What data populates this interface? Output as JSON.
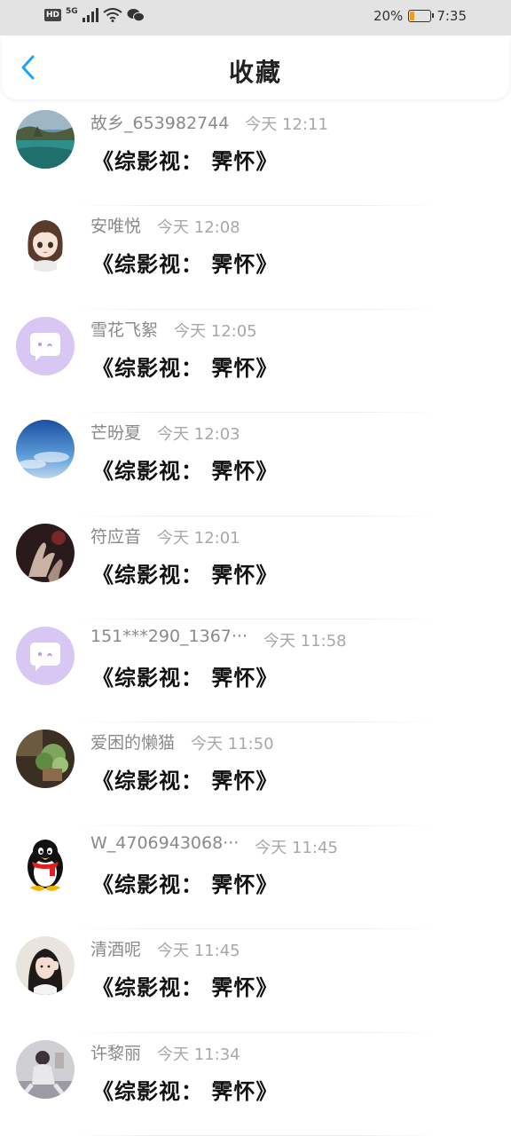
{
  "status_bar": {
    "hd": "HD",
    "network": "5G",
    "battery_text": "20%",
    "battery_level": 0.2,
    "time": "7:35"
  },
  "nav": {
    "title": "收藏",
    "back_icon": "chevron-left-icon",
    "accent_color": "#1ea0ff"
  },
  "message_text": "《综影视： 霁怀》",
  "items": [
    {
      "name": "故乡_653982744",
      "time": "今天 12:11",
      "avatar": "landscape-lake"
    },
    {
      "name": "安唯悦",
      "time": "今天 12:08",
      "avatar": "anime-girl"
    },
    {
      "name": "雪花飞絮",
      "time": "今天 12:05",
      "avatar": "default-purple"
    },
    {
      "name": "芒昐夏",
      "time": "今天 12:03",
      "avatar": "blue-sky"
    },
    {
      "name": "符应音",
      "time": "今天 12:01",
      "avatar": "dark-hands"
    },
    {
      "name": "151***290_1367···",
      "time": "今天 11:58",
      "avatar": "default-purple"
    },
    {
      "name": "爱困的懒猫",
      "time": "今天 11:50",
      "avatar": "plant-photo"
    },
    {
      "name": "W_4706943068···",
      "time": "今天 11:45",
      "avatar": "qq-penguin"
    },
    {
      "name": "清酒呢",
      "time": "今天 11:45",
      "avatar": "girl-photo"
    },
    {
      "name": "许黎丽",
      "time": "今天 11:34",
      "avatar": "girl-sitting"
    }
  ]
}
